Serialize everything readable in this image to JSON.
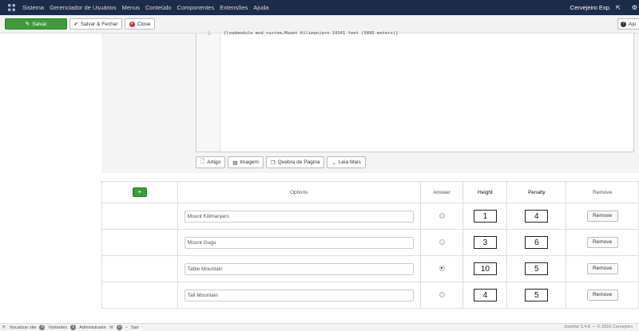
{
  "nav": {
    "items": [
      "Sistema",
      "Gerenciador de Usuários",
      "Menus",
      "Conteúdo",
      "Componentes",
      "Extensões",
      "Ajuda"
    ],
    "user": "Cervejeiro Exp.",
    "external_icon": "external-link-icon",
    "gear_icon": "gear-icon"
  },
  "toolbar": {
    "save_label": "Salvar",
    "save_close_label": "Salvar & Fechar",
    "close_label": "Close",
    "help_label": "Aju"
  },
  "editor": {
    "line_number": "1",
    "code_text": "{loadmodule mod_custom,Mount Kilimanjaro 19341 feet (5895 meters)}"
  },
  "editor_buttons": [
    "Artigo",
    "Imagem",
    "Quebra de Página",
    "Leia Mais"
  ],
  "options": {
    "add_label": "+",
    "headers": {
      "options": "Options",
      "answer": "Answer",
      "height": "Height",
      "penalty": "Penalty",
      "remove": "Remove"
    },
    "rows": [
      {
        "name": "Mount Kilimanjaro",
        "height": "1",
        "penalty": "4",
        "remove": "Remove",
        "answer": false
      },
      {
        "name": "Mount Gugu",
        "height": "3",
        "penalty": "6",
        "remove": "Remove",
        "answer": false
      },
      {
        "name": "Table Mountain",
        "height": "10",
        "penalty": "5",
        "remove": "Remove",
        "answer": true
      },
      {
        "name": "Tall Mountain",
        "height": "4",
        "penalty": "5",
        "remove": "Remove",
        "answer": false
      }
    ]
  },
  "footer": {
    "view_site": "Visualizar site",
    "visitors_count": "0",
    "visitors": "Visitantes",
    "admins_count": "1",
    "admins": "Administrador",
    "messages_count": "0",
    "logout": "Sair",
    "version": "Joomla! 3.4.8 — © 2016 Cervejeiro"
  },
  "colors": {
    "topbar": "#1c2d4b",
    "save_green": "#3e9a3b",
    "close_red": "#c0312b"
  }
}
